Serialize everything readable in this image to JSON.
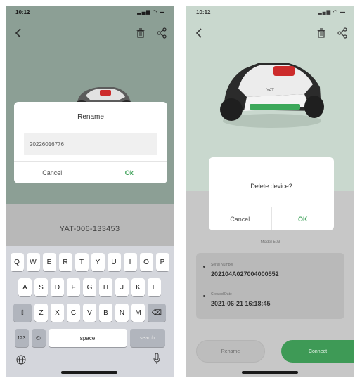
{
  "left_screen": {
    "status_bar": {
      "time": "10:12"
    },
    "rename_dialog": {
      "title": "Rename",
      "input_value": "20226016776",
      "cancel_label": "Cancel",
      "ok_label": "Ok"
    },
    "device_name": "YAT-006-133453",
    "keyboard": {
      "row1": [
        "Q",
        "W",
        "E",
        "R",
        "T",
        "Y",
        "U",
        "I",
        "O",
        "P"
      ],
      "row2": [
        "A",
        "S",
        "D",
        "F",
        "G",
        "H",
        "J",
        "K",
        "L"
      ],
      "row3": [
        "Z",
        "X",
        "C",
        "V",
        "B",
        "N",
        "M"
      ],
      "numbers_label": "123",
      "space_label": "space",
      "return_label": "search",
      "icons": [
        "shift-icon",
        "backspace-icon",
        "emoji-icon",
        "globe-icon",
        "mic-icon"
      ]
    }
  },
  "right_screen": {
    "status_bar": {
      "time": "10:12"
    },
    "delete_dialog": {
      "title": "Delete device?",
      "cancel_label": "Cancel",
      "ok_label": "OK"
    },
    "model_label": "Model 503",
    "info": {
      "serial_label": "Serial Number",
      "serial_value": "202104A027004000552",
      "created_label": "Created Date",
      "created_value": "2021-06-21 16:18:45"
    },
    "rename_button_label": "Rename",
    "connect_button_label": "Connect"
  },
  "colors": {
    "accent_green": "#3fa25a",
    "connect_button": "#3e9a56",
    "left_background": "#8c9f95",
    "right_background": "#c9d8ce"
  },
  "icons": [
    "back-icon",
    "delete-icon",
    "share-icon",
    "mower-image"
  ]
}
